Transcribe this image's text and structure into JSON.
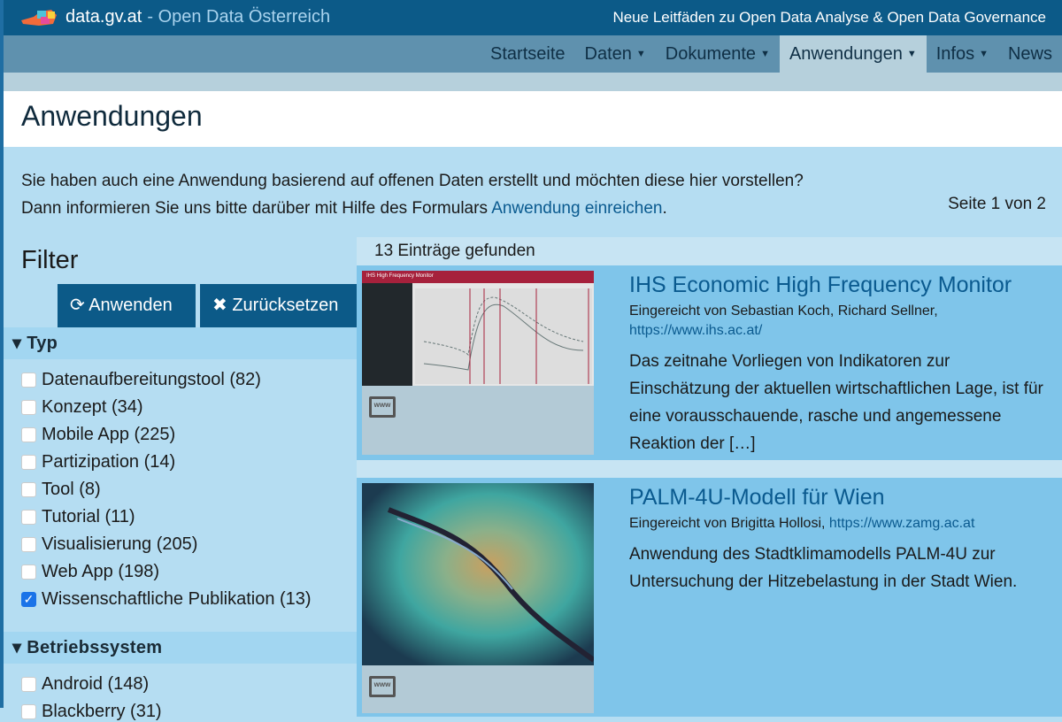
{
  "header": {
    "brand": "data.gv.at",
    "subtitle": "- Open Data Österreich",
    "announcement": "Neue Leitfäden zu Open Data Analyse & Open Data Governance"
  },
  "nav": [
    {
      "label": "Startseite",
      "dropdown": false
    },
    {
      "label": "Daten",
      "dropdown": true
    },
    {
      "label": "Dokumente",
      "dropdown": true
    },
    {
      "label": "Anwendungen",
      "dropdown": true,
      "active": true
    },
    {
      "label": "Infos",
      "dropdown": true
    },
    {
      "label": "News",
      "dropdown": false
    }
  ],
  "page_title": "Anwendungen",
  "intro": {
    "line1": "Sie haben auch eine Anwendung basierend auf offenen Daten erstellt und möchten diese hier vorstellen?",
    "line2_prefix": "Dann informieren Sie uns bitte darüber mit Hilfe des Formulars ",
    "link": "Anwendung einreichen",
    "line2_suffix": ".",
    "pagination": "Seite 1 von 2"
  },
  "filter": {
    "title": "Filter",
    "apply": "Anwenden",
    "reset": "Zurücksetzen",
    "typ": {
      "label": "Typ",
      "items": [
        {
          "label": "Datenaufbereitungstool (82)",
          "checked": false
        },
        {
          "label": "Konzept (34)",
          "checked": false
        },
        {
          "label": "Mobile App (225)",
          "checked": false
        },
        {
          "label": "Partizipation (14)",
          "checked": false
        },
        {
          "label": "Tool (8)",
          "checked": false
        },
        {
          "label": "Tutorial (11)",
          "checked": false
        },
        {
          "label": "Visualisierung (205)",
          "checked": false
        },
        {
          "label": "Web App (198)",
          "checked": false
        },
        {
          "label": "Wissenschaftliche Publikation (13)",
          "checked": true
        }
      ]
    },
    "os": {
      "label": "Betriebssystem",
      "items": [
        {
          "label": "Android (148)",
          "checked": false
        },
        {
          "label": "Blackberry (31)",
          "checked": false
        }
      ]
    }
  },
  "results": {
    "count": "13 Einträge gefunden",
    "items": [
      {
        "title": "IHS Economic High Frequency Monitor",
        "by": "Eingereicht von Sebastian Koch, Richard Sellner,",
        "url": "https://www.ihs.ac.at/",
        "desc": "Das zeitnahe Vorliegen von Indikatoren zur Einschätzung der aktuellen wirtschaftlichen Lage, ist für eine vorausschauende, rasche und angemessene Reaktion der […]",
        "thumb_title": "IHS High Frequency Monitor",
        "platform_icon": "www"
      },
      {
        "title": "PALM-4U-Modell für Wien",
        "by": "Eingereicht von Brigitta Hollosi,",
        "url": "https://www.zamg.ac.at",
        "desc": "Anwendung des Stadtklimamodells PALM-4U zur Untersuchung der Hitzebelastung in der Stadt Wien.",
        "platform_icon": "www"
      }
    ]
  }
}
